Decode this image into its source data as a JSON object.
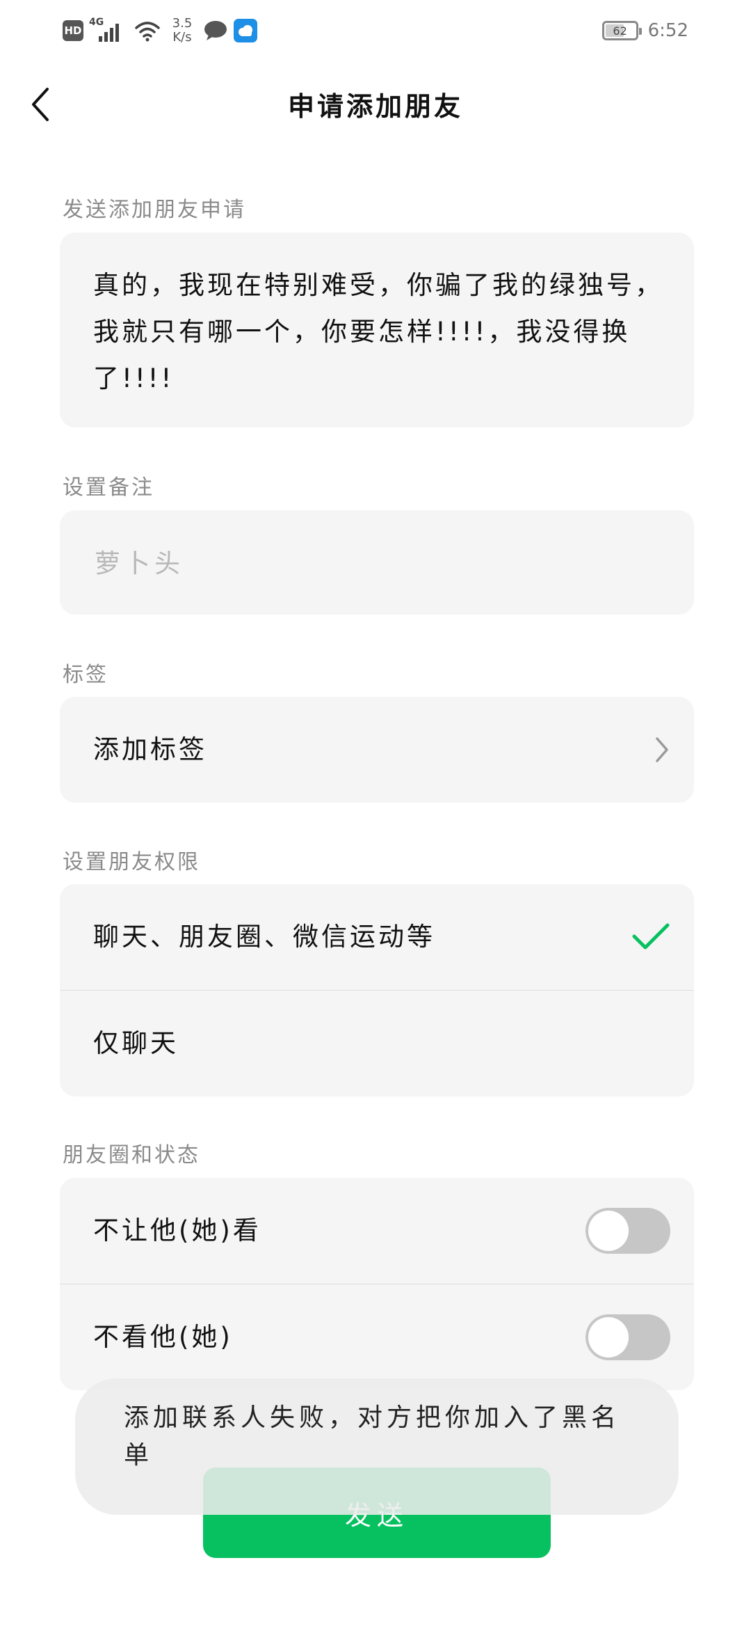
{
  "status_bar": {
    "hd": "HD",
    "network": "4G",
    "speed_value": "3.5",
    "speed_unit": "K/s",
    "battery": "62",
    "time": "6:52"
  },
  "nav": {
    "title": "申请添加朋友"
  },
  "request_message": {
    "label": "发送添加朋友申请",
    "text": "真的，我现在特别难受，你骗了我的绿独号，我就只有哪一个，你要怎样!!!!，我没得换了!!!!"
  },
  "remark": {
    "label": "设置备注",
    "placeholder": "萝卜头",
    "value": ""
  },
  "tags": {
    "label": "标签",
    "add_label": "添加标签"
  },
  "permissions": {
    "label": "设置朋友权限",
    "options": [
      {
        "label": "聊天、朋友圈、微信运动等",
        "selected": true
      },
      {
        "label": "仅聊天",
        "selected": false
      }
    ]
  },
  "moments": {
    "label": "朋友圈和状态",
    "items": [
      {
        "label": "不让他(她)看",
        "on": false
      },
      {
        "label": "不看他(她)",
        "on": false
      }
    ]
  },
  "send_button": {
    "label": "发送"
  },
  "toast": {
    "text": "添加联系人失败，对方把你加入了黑名单"
  },
  "colors": {
    "accent": "#07c160",
    "card_bg": "#f5f5f5",
    "section_label": "#8a8a8a",
    "toggle_off": "#c6c6c6"
  }
}
